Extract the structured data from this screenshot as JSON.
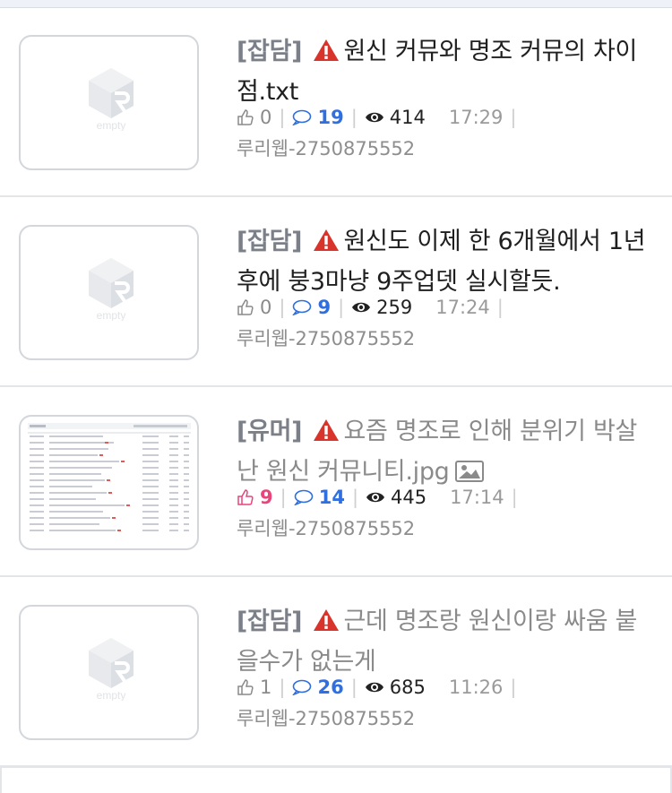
{
  "posts": [
    {
      "category": "[잡담]",
      "title": "원신 커뮤와 명조 커뮤의 차이점.txt",
      "likes": "0",
      "comments": "19",
      "views": "414",
      "time": "17:29",
      "author": "루리웹-2750875552",
      "thumb": "empty",
      "empty_label": "empty",
      "read": false,
      "hot": false
    },
    {
      "category": "[잡담]",
      "title": "원신도 이제 한 6개월에서 1년 후에 붕3마냥 9주업뎃 실시할듯.",
      "likes": "0",
      "comments": "9",
      "views": "259",
      "time": "17:24",
      "author": "루리웹-2750875552",
      "thumb": "empty",
      "empty_label": "empty",
      "read": false,
      "hot": false
    },
    {
      "category": "[유머]",
      "title": "요즘 명조로 인해 분위기 박살난 원신 커뮤니티.jpg",
      "likes": "9",
      "comments": "14",
      "views": "445",
      "time": "17:14",
      "author": "루리웹-2750875552",
      "thumb": "screenshot",
      "read": true,
      "hot": true,
      "has_image": true
    },
    {
      "category": "[잡담]",
      "title": "근데 명조랑 원신이랑 싸움 붙을수가 없는게",
      "likes": "1",
      "comments": "26",
      "views": "685",
      "time": "11:26",
      "author": "루리웹-2750875552",
      "thumb": "empty",
      "empty_label": "empty",
      "read": true,
      "hot": false
    }
  ],
  "colors": {
    "accent_blue": "#2f6fe0",
    "hot_pink": "#e8457a",
    "warning_red": "#d9342b"
  },
  "icons": {
    "warning": "warning-triangle-icon",
    "like": "thumbs-up-icon",
    "comment": "speech-bubble-icon",
    "view": "eye-icon",
    "image": "image-icon"
  }
}
